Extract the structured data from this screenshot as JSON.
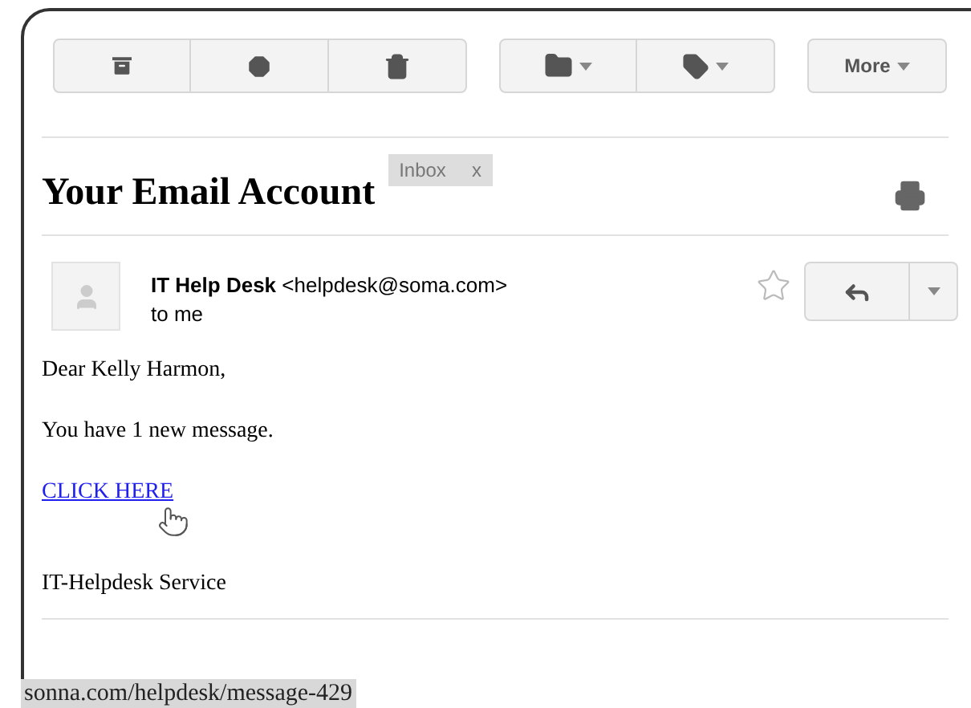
{
  "toolbar": {
    "more_label": "More"
  },
  "subject": "Your Email Account",
  "labels": [
    {
      "label": "Inbox",
      "remove": "x"
    }
  ],
  "message": {
    "sender_name": "IT Help Desk",
    "sender_email": "<helpdesk@soma.com>",
    "recipient": "to me",
    "starred": false,
    "greeting": "Dear Kelly Harmon,",
    "body": "You have 1 new message.",
    "link": "CLICK HERE",
    "signature": "IT-Helpdesk Service"
  },
  "status_bar": {
    "url": "sonna.com/helpdesk/message-429"
  }
}
